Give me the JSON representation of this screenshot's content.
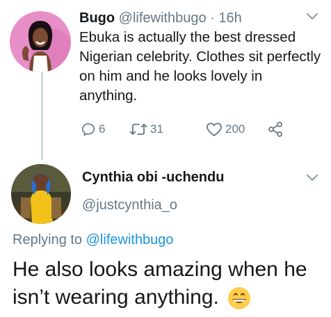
{
  "tweet": {
    "author_name": "Bugo",
    "author_handle": "@lifewithbugo",
    "separator": "·",
    "time": "16h",
    "text": "Ebuka is actually the best dressed Nigerian celebrity. Clothes sit perfectly on him and he looks lovely in anything.",
    "replies": "6",
    "retweets": "31",
    "likes": "200"
  },
  "reply": {
    "author_name": "Cynthia obi -uchendu",
    "author_handle": "@justcynthia_o",
    "replying_label": "Replying to",
    "replying_to": "@lifewithbugo",
    "text": "He also looks amazing when he isn’t wearing anything.",
    "emoji": "grinning-face-emoji"
  },
  "colors": {
    "muted": "#657786",
    "link": "#1b95e0",
    "text": "#14171a",
    "thread_line": "#cfd9de"
  }
}
